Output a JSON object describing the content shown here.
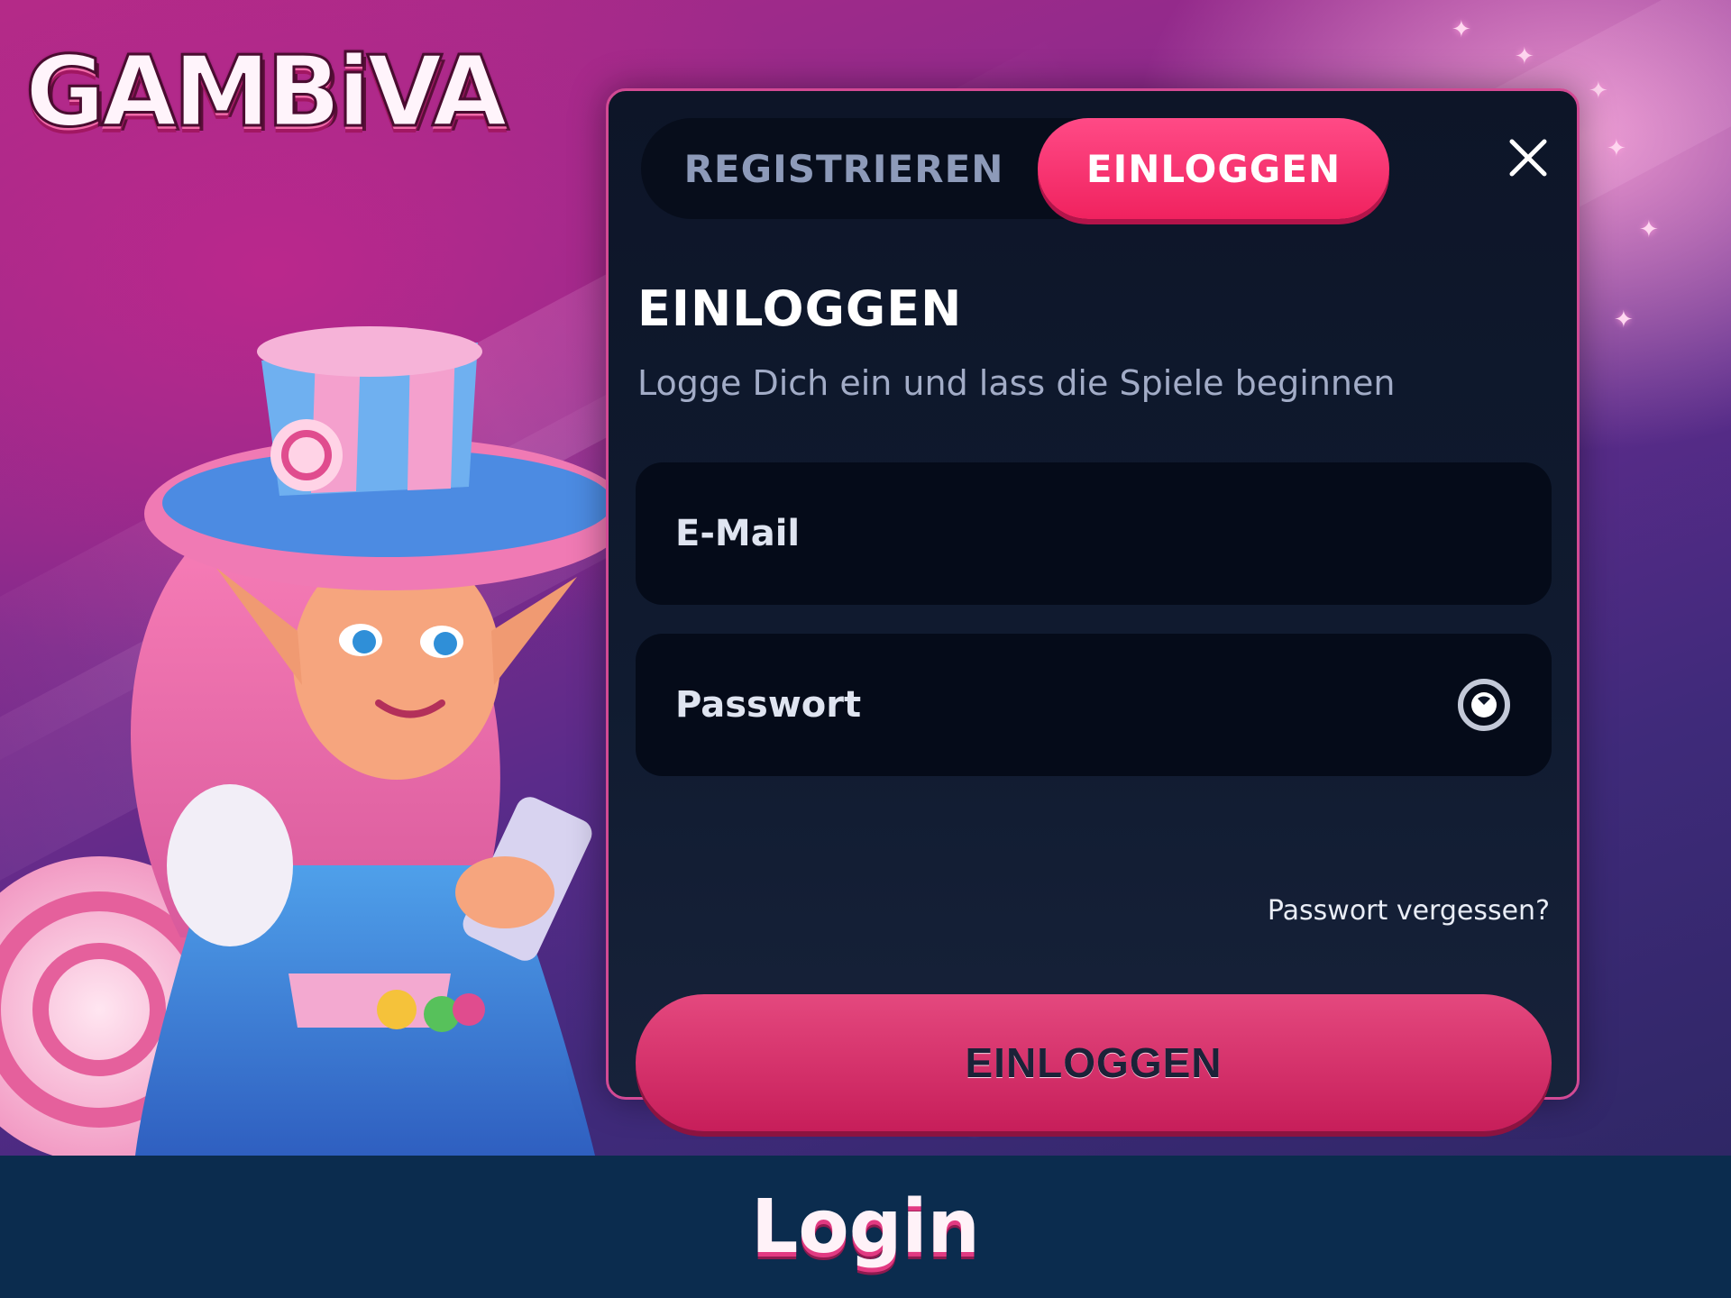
{
  "brand": {
    "logo_text": "GAMBiVA"
  },
  "modal": {
    "tabs": [
      {
        "label": "REGISTRIEREN",
        "active": false
      },
      {
        "label": "EINLOGGEN",
        "active": true
      }
    ],
    "close_icon": "close-icon",
    "title": "EINLOGGEN",
    "subtitle": "Logge Dich ein und lass die Spiele beginnen",
    "email": {
      "value": "",
      "placeholder": "E-Mail"
    },
    "password": {
      "value": "",
      "placeholder": "Passwort",
      "toggle_icon": "eye-icon"
    },
    "forgot_link": "Passwort vergessen?",
    "submit_label": "EINLOGGEN"
  },
  "caption": "Login",
  "colors": {
    "accent_pink": "#f0225f",
    "modal_bg": "#0d1528",
    "modal_border": "#d24a94",
    "caption_band": "#0b2c4e"
  }
}
